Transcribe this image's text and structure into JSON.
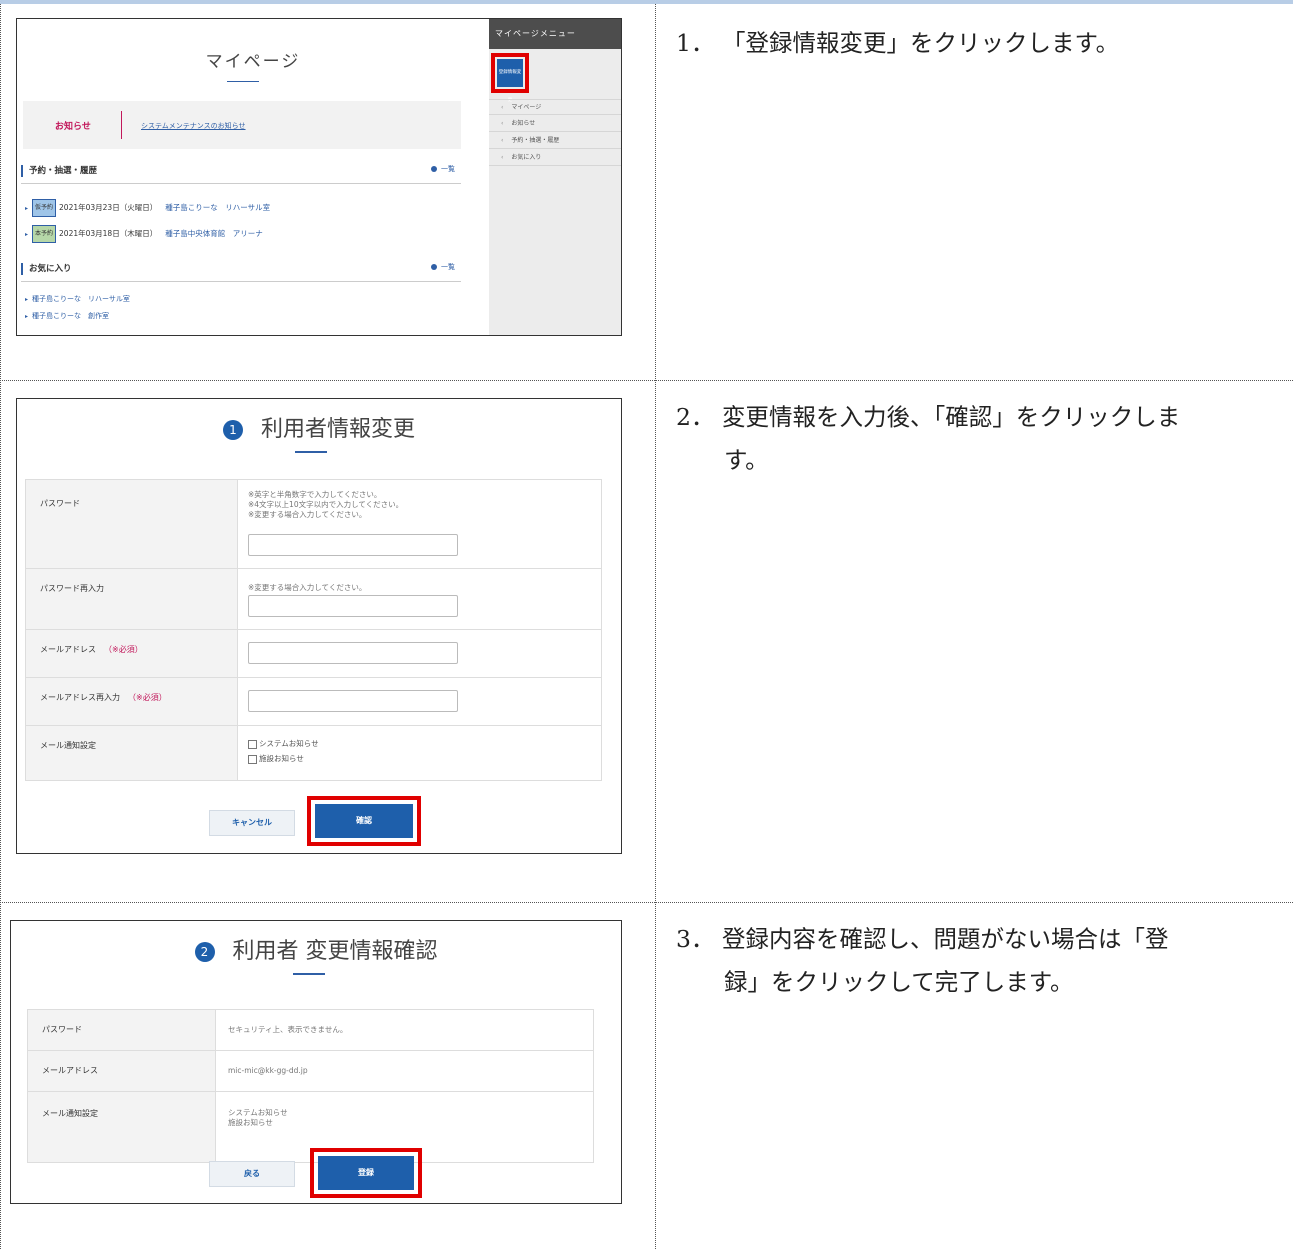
{
  "steps": [
    {
      "num": "1．",
      "text": "「登録情報変更」をクリックします。",
      "cont": ""
    },
    {
      "num": "2．",
      "text": "変更情報を入力後、「確認」をクリックしま",
      "cont": "す。"
    },
    {
      "num": "3．",
      "text": "登録内容を確認し、問題がない場合は「登",
      "cont": "録」をクリックして完了します。"
    }
  ],
  "mypage": {
    "title": "マイページ",
    "notice_label": "お知らせ",
    "notice_link": "システムメンテナンスのお知らせ",
    "reservations_heading": "予約・抽選・履歴",
    "more": "一覧",
    "reservations": [
      {
        "badge": "仮予約",
        "date": "2021年03月23日（火曜日）",
        "facility": "種子島こりーな　リハーサル室"
      },
      {
        "badge": "本予約",
        "date": "2021年03月18日（木曜日）",
        "facility": "種子島中央体育館　アリーナ"
      }
    ],
    "favorites_heading": "お気に入り",
    "favorites": [
      "種子島こりーな　リハーサル室",
      "種子島こりーな　創作室"
    ],
    "menu_title": "マイページメニュー",
    "menu_button": "登録情報変更",
    "menu_items": [
      "マイページ",
      "お知らせ",
      "予約・抽選・履歴",
      "お気に入り"
    ]
  },
  "edit_form": {
    "step": "1",
    "title": "利用者情報変更",
    "password_label": "パスワード",
    "password_notes": [
      "※英字と半角数字で入力してください。",
      "※4文字以上10文字以内で入力してください。",
      "※変更する場合入力してください。"
    ],
    "password_re_label": "パスワード再入力",
    "password_re_note": "※変更する場合入力してください。",
    "email_label": "メールアドレス",
    "email_re_label": "メールアドレス再入力",
    "required": "（※必須）",
    "notify_label": "メール通知設定",
    "notify_options": [
      "システムお知らせ",
      "施設お知らせ"
    ],
    "cancel": "キャンセル",
    "confirm": "確認"
  },
  "confirm_form": {
    "step": "2",
    "title": "利用者 変更情報確認",
    "password_label": "パスワード",
    "password_value": "セキュリティ上、表示できません。",
    "email_label": "メールアドレス",
    "email_value": "mic-mic@kk-gg-dd.jp",
    "notify_label": "メール通知設定",
    "notify_values": [
      "システムお知らせ",
      "施設お知らせ"
    ],
    "back": "戻る",
    "register": "登録"
  },
  "colors": {
    "accent": "#1e5fab",
    "highlight": "#e00000",
    "notice": "#c2185b"
  }
}
